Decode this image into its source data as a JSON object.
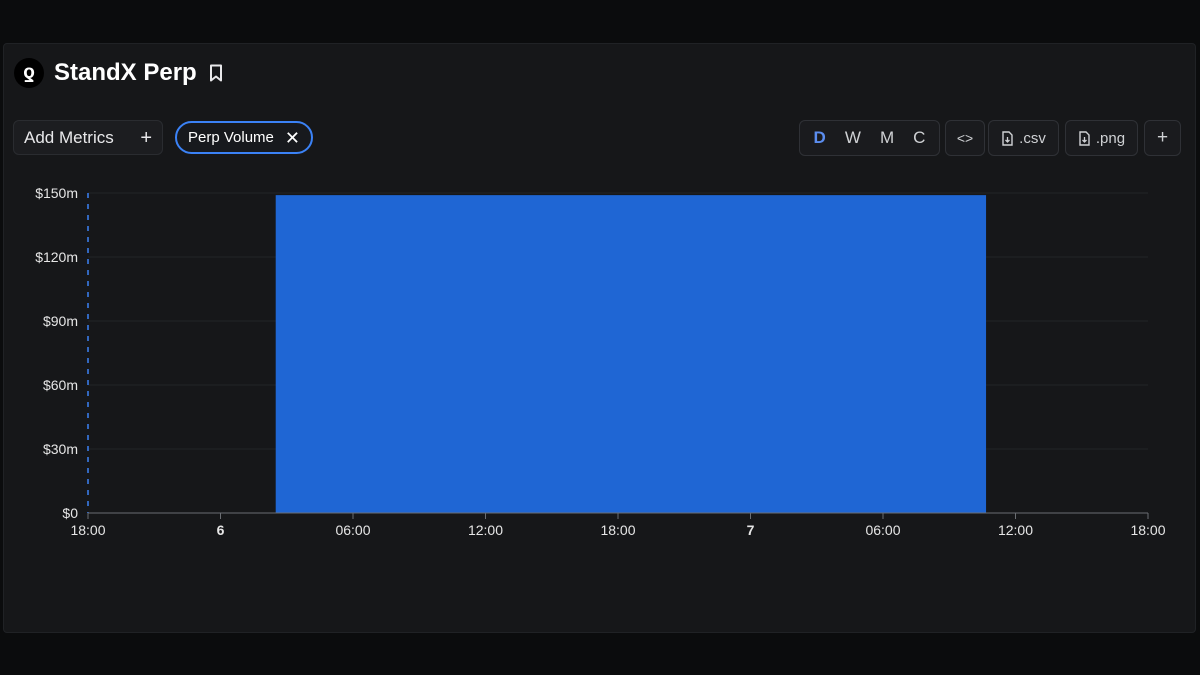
{
  "header": {
    "logo_glyph": "ƍ",
    "title": "StandX Perp",
    "icon": "bookmark-icon"
  },
  "toolbar": {
    "add_metrics_label": "Add Metrics",
    "add_metrics_icon": "plus-icon",
    "metric_chip_label": "Perp Volume",
    "metric_chip_remove_icon": "close-icon",
    "timeframes": [
      {
        "label": "D",
        "active": true
      },
      {
        "label": "W",
        "active": false
      },
      {
        "label": "M",
        "active": false
      },
      {
        "label": "C",
        "active": false
      }
    ],
    "embed_icon": "code-icon",
    "csv_label": ".csv",
    "png_label": ".png",
    "download_icon": "file-download-icon",
    "more_icon": "plus-icon"
  },
  "colors": {
    "accent": "#3b82f6",
    "bar": "#1f66d4",
    "background": "#161719",
    "text": "#e8e8ea"
  },
  "chart_data": {
    "type": "bar",
    "series": [
      {
        "start": "2023-09-06 02:30",
        "end": "2023-09-07 10:40",
        "value": 149000000
      }
    ],
    "x_range": [
      "2023-09-05 18:00",
      "2023-09-07 18:00"
    ],
    "x_ticks": [
      {
        "at": "2023-09-05 18:00",
        "label": "18:00",
        "bold": false
      },
      {
        "at": "2023-09-06 00:00",
        "label": "6",
        "bold": true
      },
      {
        "at": "2023-09-06 06:00",
        "label": "06:00",
        "bold": false
      },
      {
        "at": "2023-09-06 12:00",
        "label": "12:00",
        "bold": false
      },
      {
        "at": "2023-09-06 18:00",
        "label": "18:00",
        "bold": false
      },
      {
        "at": "2023-09-07 00:00",
        "label": "7",
        "bold": true
      },
      {
        "at": "2023-09-07 06:00",
        "label": "06:00",
        "bold": false
      },
      {
        "at": "2023-09-07 12:00",
        "label": "12:00",
        "bold": false
      },
      {
        "at": "2023-09-07 18:00",
        "label": "18:00",
        "bold": false
      }
    ],
    "y_ticks": [
      {
        "value": 0,
        "label": "$0"
      },
      {
        "value": 30000000,
        "label": "$30m"
      },
      {
        "value": 60000000,
        "label": "$60m"
      },
      {
        "value": 90000000,
        "label": "$90m"
      },
      {
        "value": 120000000,
        "label": "$120m"
      },
      {
        "value": 150000000,
        "label": "$150m"
      }
    ],
    "ylim": [
      0,
      150000000
    ],
    "grid": true
  }
}
